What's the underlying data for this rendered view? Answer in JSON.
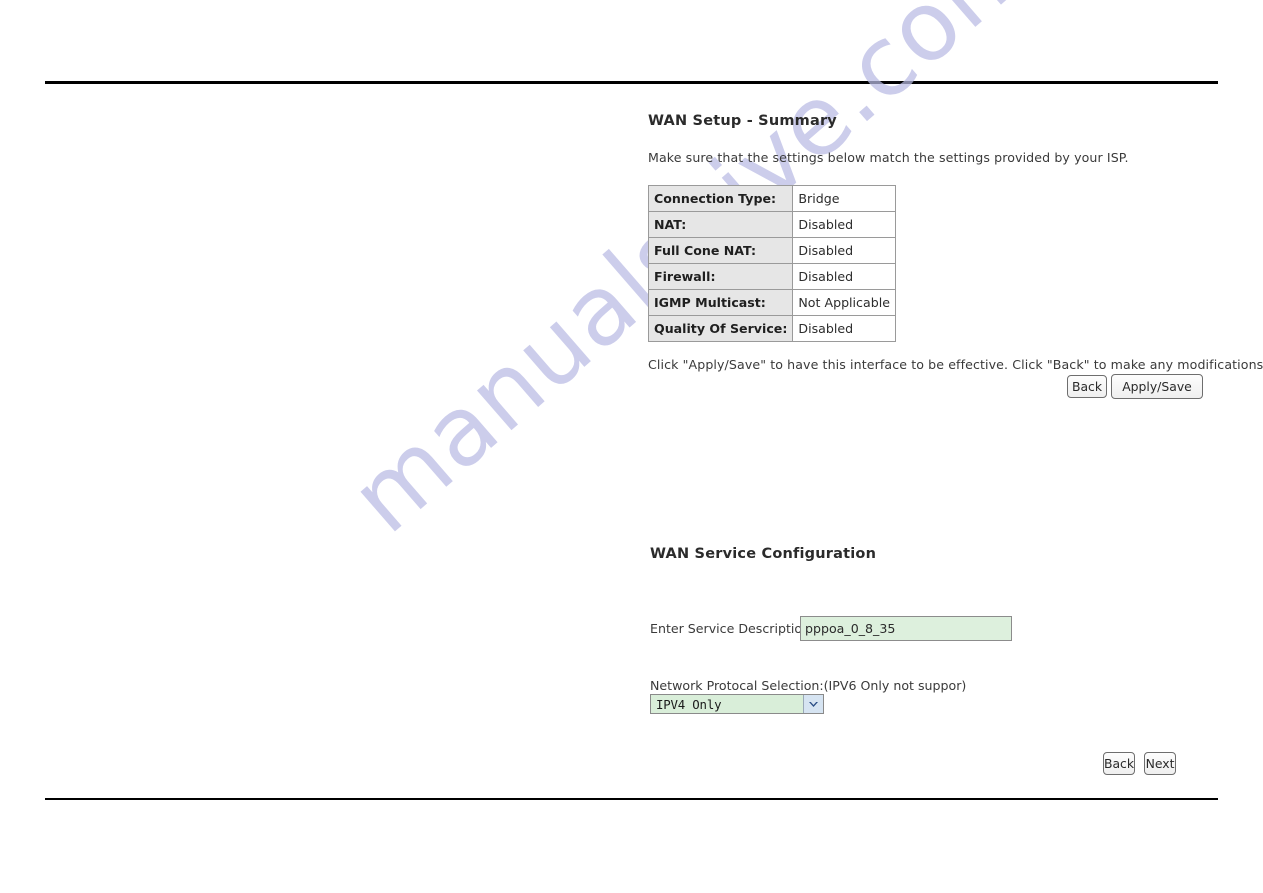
{
  "page": {
    "watermark": "manualshive.com"
  },
  "summary": {
    "title": "WAN Setup - Summary",
    "intro": "Make sure that the settings below match the settings provided by your ISP.",
    "rows": [
      {
        "key": "Connection Type:",
        "value": "Bridge"
      },
      {
        "key": "NAT:",
        "value": "Disabled"
      },
      {
        "key": "Full Cone NAT:",
        "value": "Disabled"
      },
      {
        "key": "Firewall:",
        "value": "Disabled"
      },
      {
        "key": "IGMP Multicast:",
        "value": "Not Applicable"
      },
      {
        "key": "Quality Of Service:",
        "value": "Disabled"
      }
    ],
    "instruction": "Click \"Apply/Save\" to have this interface to be effective. Click \"Back\" to make any modifications.",
    "back_label": "Back",
    "apply_save_label": "Apply/Save"
  },
  "wan_service": {
    "title": "WAN Service Configuration",
    "service_description_label": "Enter Service Description:",
    "service_description_value": "pppoa_0_8_35",
    "protocol_label": "Network Protocal Selection:(IPV6 Only not suppor)",
    "protocol_value": "IPV4 Only",
    "back_label": "Back",
    "next_label": "Next"
  },
  "colors": {
    "field_green": "#ddf0dd",
    "table_header_gray": "#e6e6e6",
    "watermark_lavender": "#b9bbe4",
    "arrow_blue": "#2c4f86"
  }
}
